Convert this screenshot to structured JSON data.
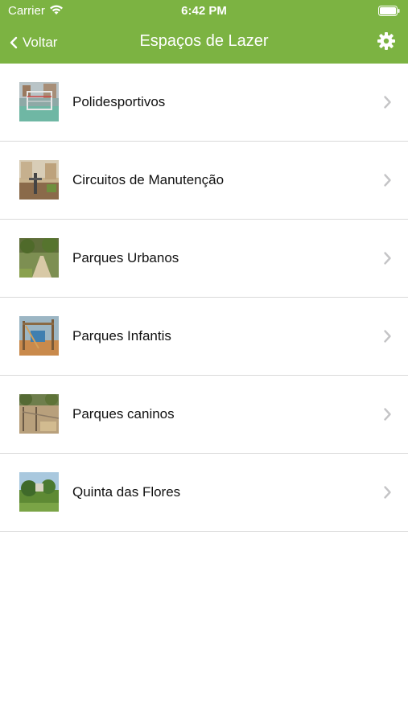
{
  "status_bar": {
    "carrier": "Carrier",
    "time": "6:42 PM",
    "wifi_icon": "wifi-icon",
    "battery_icon": "battery-icon"
  },
  "nav": {
    "back_label": "Voltar",
    "back_icon": "chevron-left-icon",
    "title": "Espaços de Lazer",
    "settings_icon": "gear-icon"
  },
  "colors": {
    "header_bg": "#7cb342",
    "header_text": "#ffffff",
    "chevron": "#c4c4c6",
    "separator": "#d9d9d9"
  },
  "items": [
    {
      "label": "Polidesportivos",
      "thumbnail": "sports-court-photo"
    },
    {
      "label": "Circuitos de Manutenção",
      "thumbnail": "fitness-circuit-photo"
    },
    {
      "label": "Parques Urbanos",
      "thumbnail": "urban-park-photo"
    },
    {
      "label": "Parques Infantis",
      "thumbnail": "playground-photo"
    },
    {
      "label": "Parques caninos",
      "thumbnail": "dog-park-photo"
    },
    {
      "label": "Quinta das Flores",
      "thumbnail": "garden-photo"
    }
  ]
}
